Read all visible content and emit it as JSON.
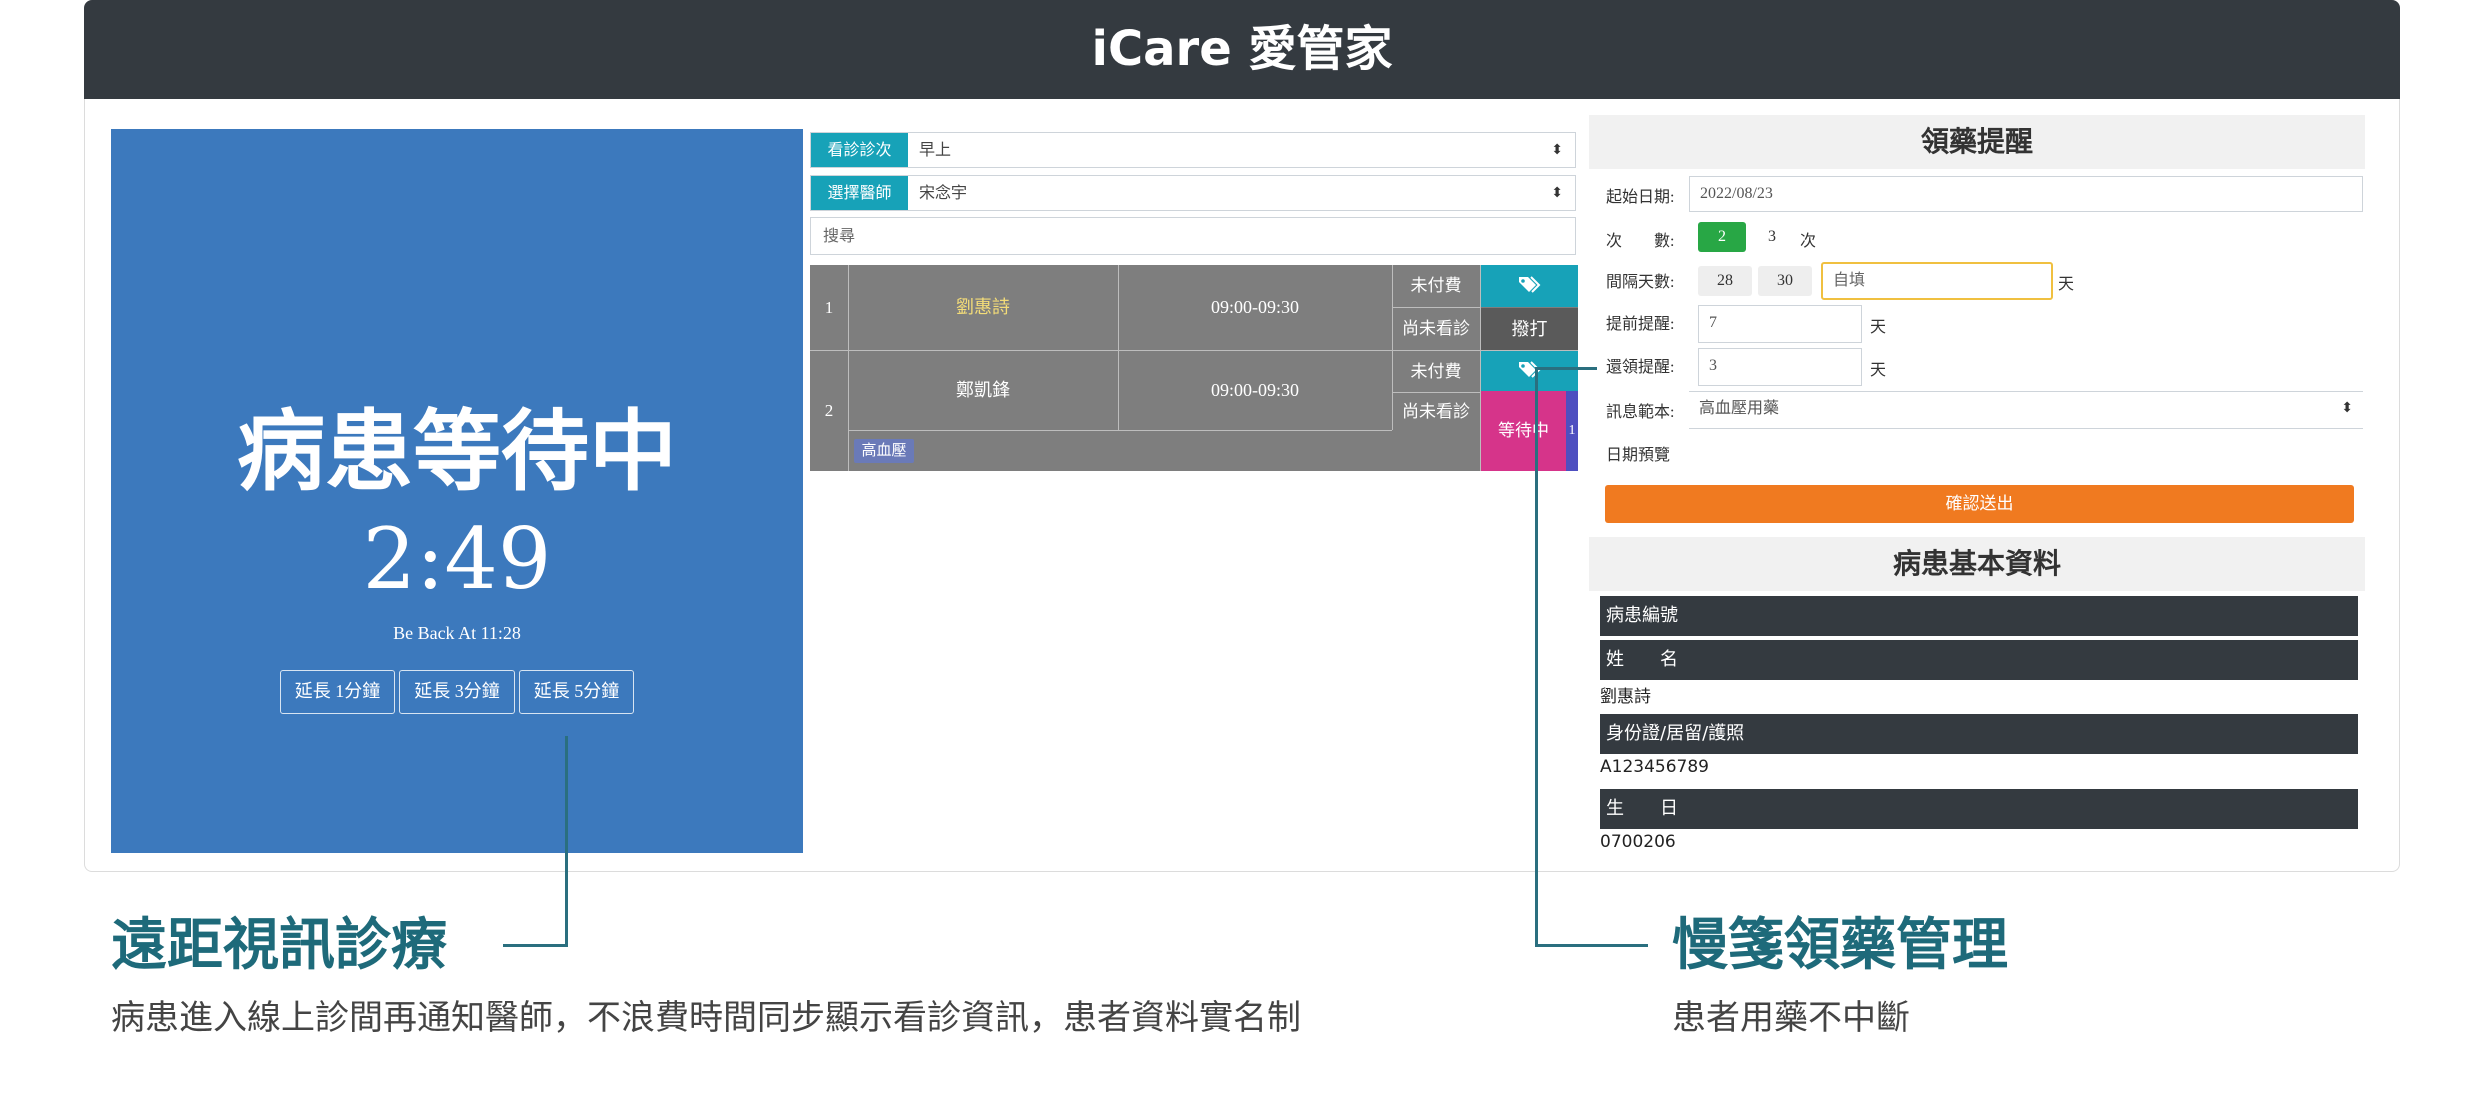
{
  "header": {
    "title": "iCare 愛管家"
  },
  "video": {
    "status": "病患等待中",
    "timer": "2:49",
    "back_at": "Be Back At 11:28",
    "buttons": [
      "延長 1分鐘",
      "延長 3分鐘",
      "延長 5分鐘"
    ]
  },
  "schedule": {
    "session_label": "看診診次",
    "session_value": "早上",
    "doctor_label": "選擇醫師",
    "doctor_value": "宋念宇",
    "search_placeholder": "搜尋",
    "rows": [
      {
        "no": "1",
        "name": "劉惠詩",
        "time": "09:00-09:30",
        "pay": "未付費",
        "visit": "尚未看診",
        "action": "撥打"
      },
      {
        "no": "2",
        "name": "鄭凱鋒",
        "time": "09:00-09:30",
        "pay": "未付費",
        "visit": "尚未看診",
        "action": "等待中",
        "count": "1",
        "tag": "高血壓"
      }
    ]
  },
  "reminder": {
    "title": "領藥提醒",
    "start_label": "起始日期:",
    "start_value": "2022/08/23",
    "times_label": "次　　數:",
    "times_options": [
      "2",
      "3"
    ],
    "times_unit": "次",
    "interval_label": "間隔天數:",
    "interval_options": [
      "28",
      "30"
    ],
    "interval_custom_placeholder": "自填",
    "day_unit": "天",
    "advance_label": "提前提醒:",
    "advance_value": "7",
    "return_label": "還領提醒:",
    "return_value": "3",
    "template_label": "訊息範本:",
    "template_value": "高血壓用藥",
    "preview_label": "日期預覽",
    "submit_label": "確認送出"
  },
  "patient": {
    "title": "病患基本資料",
    "fields": [
      {
        "label": "病患編號",
        "value": ""
      },
      {
        "label": "姓　　名",
        "value": "劉惠詩"
      },
      {
        "label": "身份證/居留/護照",
        "value": "A123456789"
      },
      {
        "label": "生　　日",
        "value": "0700206"
      }
    ]
  },
  "captions": {
    "left_title": "遠距視訊診療",
    "left_text": "病患進入線上診間再通知醫師，不浪費時間同步顯示看診資訊，患者資料實名制",
    "right_title": "慢箋領藥管理",
    "right_text": "患者用藥不中斷"
  },
  "colors": {
    "header": "#343a40",
    "video": "#3c79bd",
    "teal": "#17a2b8",
    "pink": "#d6348a",
    "orange": "#f07a20",
    "green": "#28a745",
    "caption": "#1e6a7a"
  },
  "icons": {
    "tag": "tag-icon",
    "select_arrow": "sort-arrows-icon"
  }
}
